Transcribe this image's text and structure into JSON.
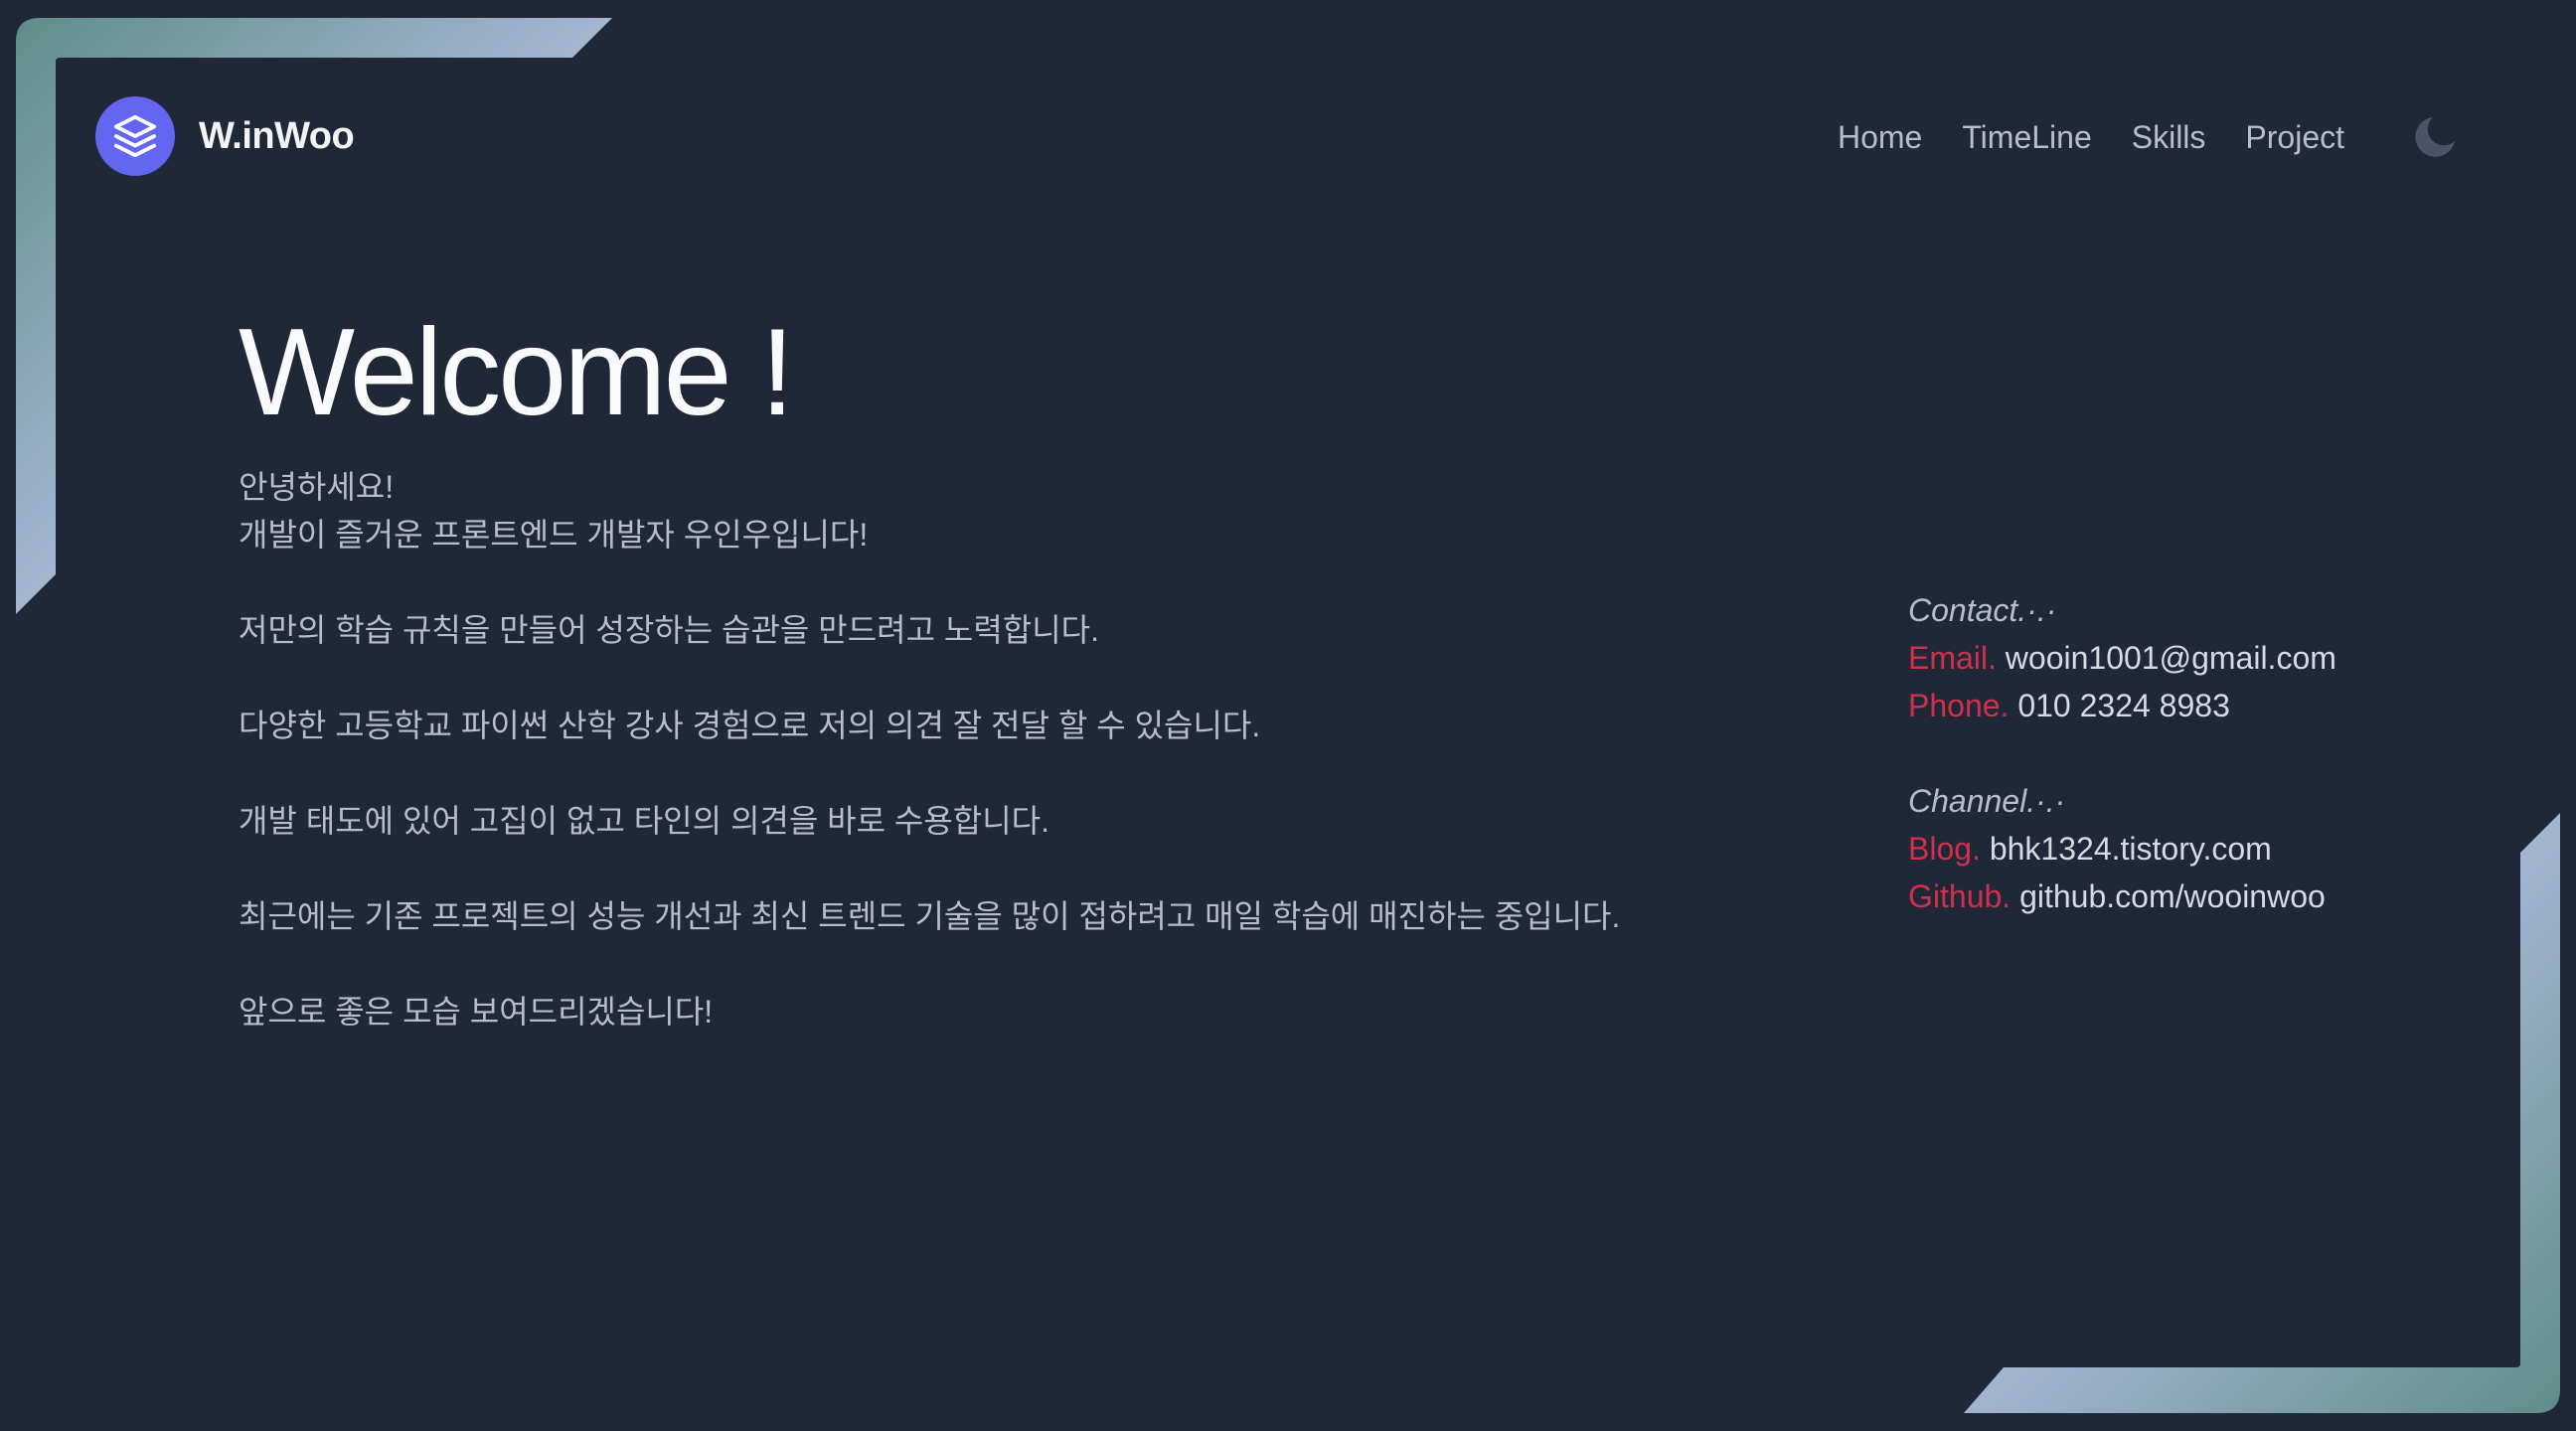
{
  "brand": {
    "name": "W.inWoo",
    "logo_icon": "layers-icon",
    "logo_color": "#6366f1"
  },
  "nav": {
    "items": [
      {
        "label": "Home"
      },
      {
        "label": "TimeLine"
      },
      {
        "label": "Skills"
      },
      {
        "label": "Project"
      }
    ],
    "theme_toggle_icon": "moon-icon"
  },
  "hero": {
    "title": "Welcome !",
    "paragraphs": [
      "안녕하세요!",
      "개발이 즐거운 프론트엔드 개발자 우인우입니다!",
      "저만의 학습 규칙을 만들어 성장하는 습관을 만드려고 노력합니다.",
      "다양한 고등학교 파이썬 산학 강사 경험으로 저의 의견 잘 전달 할 수 있습니다.",
      "개발 태도에 있어 고집이 없고 타인의 의견을 바로 수용합니다.",
      "최근에는 기존 프로젝트의 성능 개선과 최신 트렌드 기술을 많이 접하려고 매일 학습에 매진하는 중입니다.",
      "앞으로 좋은 모습 보여드리겠습니다!"
    ]
  },
  "contact": {
    "heading": "Contact.·.·",
    "email_key": "Email.",
    "email_value": "wooin1001@gmail.com",
    "phone_key": "Phone.",
    "phone_value": "010 2324 8983"
  },
  "channel": {
    "heading": "Channel.·.·",
    "blog_key": "Blog.",
    "blog_value": "bhk1324.tistory.com",
    "github_key": "Github.",
    "github_value": "github.com/wooinwoo"
  },
  "colors": {
    "background": "#202838",
    "accent_key": "#d0304e",
    "frame_gradient_start": "#5b8a84",
    "frame_gradient_end": "#e2d5f8"
  }
}
